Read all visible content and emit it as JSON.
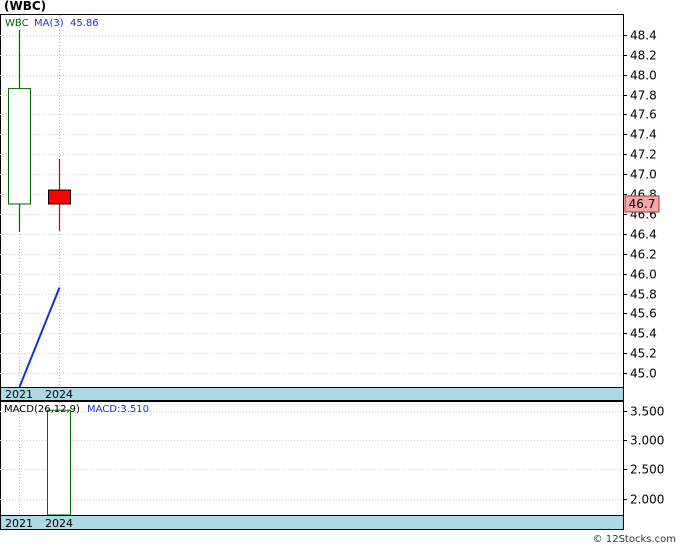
{
  "title": "(WBC)",
  "credit": "© 12Stocks.com",
  "chart_data": [
    {
      "type": "candlestick",
      "legend": {
        "symbol": "WBC",
        "ma_label": "MA(3)",
        "ma_value": "45.86"
      },
      "x_labels": [
        "2021",
        "2024"
      ],
      "ylim": [
        44.86,
        48.6
      ],
      "y_ticks": [
        "48.4",
        "48.2",
        "48.0",
        "47.8",
        "47.6",
        "47.4",
        "47.2",
        "47.0",
        "46.8",
        "46.6",
        "46.4",
        "46.2",
        "46.0",
        "45.8",
        "45.6",
        "45.4",
        "45.2",
        "45.0"
      ],
      "last_price": "46.7",
      "candles": [
        {
          "x": "2021",
          "open": 46.7,
          "close": 47.86,
          "high": 48.45,
          "low": 46.42,
          "color": "#ffffff",
          "border": "#006600"
        },
        {
          "x": "2024",
          "open": 46.84,
          "close": 46.7,
          "high": 47.15,
          "low": 46.43,
          "color": "#ff0000",
          "border": "#000000"
        }
      ],
      "ma_line": {
        "x": [
          "2021",
          "2024"
        ],
        "values": [
          44.86,
          45.86
        ],
        "color": "#1a2fd6"
      },
      "last_price_color": "#f4a8a8"
    },
    {
      "type": "bar",
      "legend": {
        "name": "MACD(26,12,9)",
        "value_label": "MACD:3.510"
      },
      "x_labels": [
        "2021",
        "2024"
      ],
      "ylim": [
        1.72,
        3.65
      ],
      "y_ticks": [
        "3.500",
        "3.000",
        "2.500",
        "2.000"
      ],
      "bars": [
        {
          "x": "2024",
          "value": 3.51,
          "color": "#ffffff",
          "border": "#006600"
        }
      ]
    }
  ]
}
